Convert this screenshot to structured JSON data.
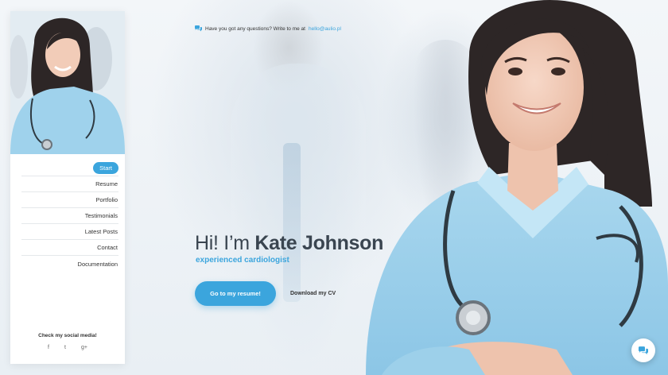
{
  "contact": {
    "text": "Have you got any questions? Write to me at",
    "email": "hello@aulio.pl"
  },
  "sidebar": {
    "items": [
      {
        "label": "Start"
      },
      {
        "label": "Resume"
      },
      {
        "label": "Portfolio"
      },
      {
        "label": "Testimonials"
      },
      {
        "label": "Latest Posts"
      },
      {
        "label": "Contact"
      },
      {
        "label": "Documentation"
      }
    ],
    "social_title": "Check my social media!",
    "social": [
      "f",
      "t",
      "g+"
    ]
  },
  "hero": {
    "greeting": "Hi! I’m",
    "name": "Kate Johnson",
    "subtitle": "experienced cardiologist",
    "primary_button": "Go to my resume!",
    "secondary_button": "Download my CV"
  },
  "colors": {
    "accent": "#3ba5dd",
    "text": "#3a4550"
  },
  "icons": {
    "contact": "chat-bubbles-icon",
    "fab": "chat-bubbles-icon",
    "social": [
      "facebook-icon",
      "twitter-icon",
      "google-plus-icon"
    ]
  }
}
